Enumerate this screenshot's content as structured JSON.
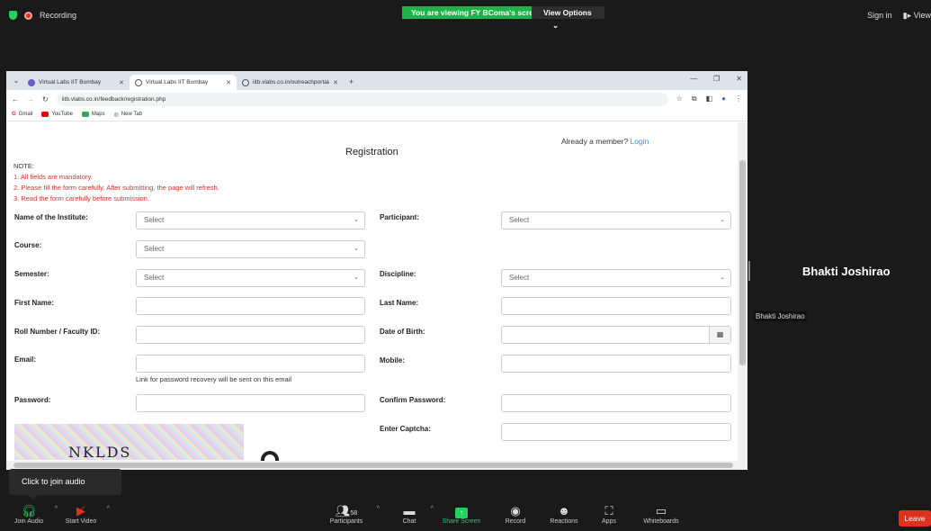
{
  "zoom": {
    "recording_label": "Recording",
    "viewing_banner": "You are viewing FY BComa's screen",
    "view_options_label": "View Options",
    "sign_in_label": "Sign in",
    "view_label": "View",
    "participant_name": "Bhakti Joshirao",
    "participant_tag": "Bhakti Joshirao",
    "tooltip": "Click to join audio",
    "toolbar": {
      "join_audio": "Join Audio",
      "start_video": "Start Video",
      "participants_count": "58",
      "participants": "Participants",
      "chat": "Chat",
      "share_screen": "Share Screen",
      "record": "Record",
      "reactions": "Reactions",
      "apps": "Apps",
      "whiteboards": "Whiteboards",
      "leave": "Leave"
    },
    "colors": {
      "share_green": "#23d160",
      "leave_red": "#e0301e"
    }
  },
  "browser": {
    "tabs": [
      {
        "title": "Virtual Labs IIT Bombay",
        "active": false
      },
      {
        "title": "Virtual Labs IIT Bombay",
        "active": true
      },
      {
        "title": "iitb.vlabs.co.in/outreachportal/",
        "active": false
      }
    ],
    "url": "iitb.vlabs.co.in/feedback/registration.php",
    "bookmarks": [
      "Gmail",
      "YouTube",
      "Maps",
      "New Tab"
    ]
  },
  "form": {
    "member_text": "Already a member?",
    "login_link": "Login",
    "title": "Registration",
    "note_label": "NOTE:",
    "notes": [
      "1. All fields are mandatory.",
      "2. Please fill the form carefully. After submitting, the page will refresh.",
      "3. Read the form carefully before submission."
    ],
    "labels": {
      "institute": "Name of the Institute:",
      "participant": "Participant:",
      "course": "Course:",
      "semester": "Semester:",
      "discipline": "Discipline:",
      "first_name": "First Name:",
      "last_name": "Last Name:",
      "roll_number": "Roll Number / Faculty ID:",
      "dob": "Date of Birth:",
      "email": "Email:",
      "mobile": "Mobile:",
      "password": "Password:",
      "confirm_password": "Confirm Password:",
      "captcha": "Enter Captcha:"
    },
    "select_placeholder": "Select",
    "email_hint": "Link for password recovery will be sent on this email",
    "captcha_text": "NKLDS"
  }
}
